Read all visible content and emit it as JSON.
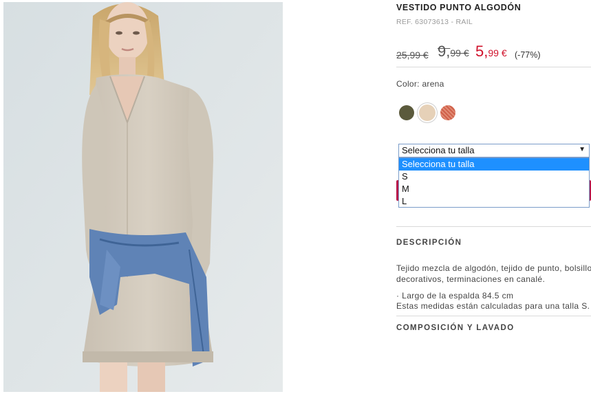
{
  "product": {
    "title": "VESTIDO PUNTO ALGODÓN",
    "ref": "REF. 63073613 - RAIL"
  },
  "prices": {
    "original": "25,99 €",
    "previous_int": "9,",
    "previous_dec": "99 €",
    "current_int": "5,",
    "current_dec": "99 €",
    "discount": "(-77%)"
  },
  "color": {
    "label": "Color: arena",
    "swatches": [
      {
        "name": "olive",
        "hex": "#5b5a3c"
      },
      {
        "name": "arena",
        "hex": "#e6d1b8",
        "selected": true
      },
      {
        "name": "coral",
        "hex": "#d0604a"
      }
    ]
  },
  "size_select": {
    "value": "Selecciona tu talla",
    "options": [
      "Selecciona tu talla",
      "S",
      "M",
      "L"
    ]
  },
  "description": {
    "heading": "DESCRIPCIÓN",
    "line1": "Tejido mezcla de algodón, tejido de punto, bolsillos",
    "line2": "decorativos, terminaciones en canalé.",
    "line3": "· Largo de la espalda 84.5 cm",
    "line4": "Estas medidas están calculadas para una talla S."
  },
  "composition": {
    "heading": "COMPOSICIÓN Y LAVADO"
  },
  "colors": {
    "accent_red": "#d0102a",
    "buy_button": "#b8174a",
    "highlight": "#1e90ff"
  }
}
